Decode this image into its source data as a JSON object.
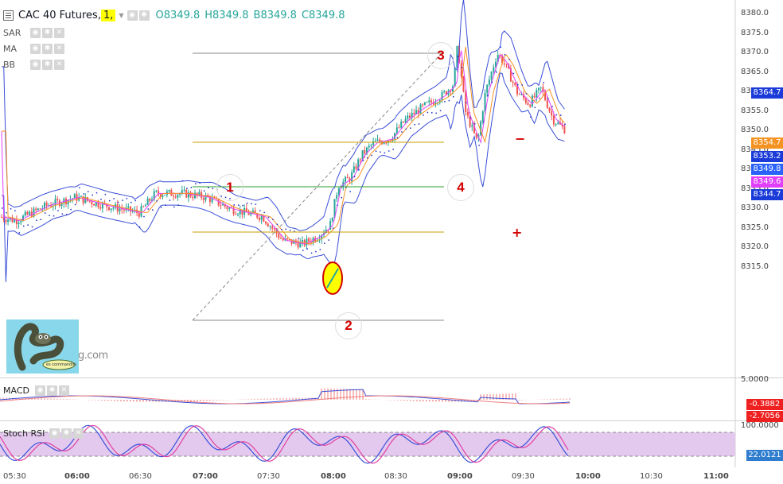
{
  "legend": {
    "symbol": "CAC 40 Futures",
    "interval": "1",
    "open": "O8349.8",
    "high": "H8349.8",
    "low": "B8349.8",
    "close": "C8349.8"
  },
  "indicators": [
    "SAR",
    "MA",
    "BB"
  ],
  "price_axis": {
    "ticks": [
      "8380.0",
      "8375.0",
      "8370.0",
      "8365.0",
      "8360.0",
      "8355.0",
      "8350.0",
      "8345.0",
      "8340.0",
      "8335.0",
      "8330.0",
      "8325.0",
      "8320.0",
      "8315.0"
    ],
    "tags": [
      {
        "text": "8364.7",
        "color": "#1a3bd8"
      },
      {
        "text": "8354.7",
        "color": "#f59322"
      },
      {
        "text": "8353.2",
        "color": "#1a3bd8"
      },
      {
        "text": "8349.8",
        "color": "#2962ff"
      },
      {
        "text": "8349.6",
        "color": "#e040fb"
      },
      {
        "text": "8344.7",
        "color": "#1a3bd8"
      }
    ]
  },
  "annotations": {
    "point1": "1",
    "point2": "2",
    "point3": "3",
    "point4": "4"
  },
  "macd": {
    "label": "MACD",
    "axis_top": "5.0000",
    "value1": "-0.3882",
    "value2": "-2.7056"
  },
  "stoch": {
    "label": "Stoch RSI",
    "axis_top": "100.0000",
    "value": "22.0121"
  },
  "time_axis": [
    "05:30",
    "06:00",
    "06:30",
    "07:00",
    "07:30",
    "08:00",
    "08:30",
    "09:00",
    "09:30",
    "10:00",
    "10:30",
    "11:00"
  ],
  "logo_suffix": "g.com",
  "logo_bubble": "es commandos"
}
